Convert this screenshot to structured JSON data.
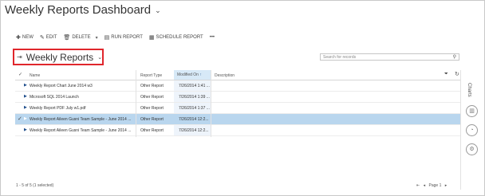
{
  "header": {
    "title": "Weekly Reports Dashboard"
  },
  "toolbar": {
    "new": "NEW",
    "edit": "EDIT",
    "delete": "DELETE",
    "run_report": "RUN REPORT",
    "schedule_report": "SCHEDULE REPORT",
    "more": "•••"
  },
  "view": {
    "name": "Weekly Reports"
  },
  "search": {
    "placeholder": "Search for records"
  },
  "grid": {
    "columns": {
      "name": "Name",
      "report_type": "Report Type",
      "modified_on": "Modified On",
      "description": "Description"
    },
    "rows": [
      {
        "name": "Weekly Report Chart June 2014 w3",
        "report_type": "Other Report",
        "modified_on": "7/26/2014 1:41 ...",
        "selected": false
      },
      {
        "name": "Microsoft SQL 2014 Launch",
        "report_type": "Other Report",
        "modified_on": "7/26/2014 1:39 ...",
        "selected": false
      },
      {
        "name": "Weekly Report PDF July w1.pdf",
        "report_type": "Other Report",
        "modified_on": "7/26/2014 1:37 ...",
        "selected": false
      },
      {
        "name": "Weekly Report Aileen Gusni Team Sample - June 2014 ...",
        "report_type": "Other Report",
        "modified_on": "7/26/2014 12:2...",
        "selected": true
      },
      {
        "name": "Weekly Report Aileen Gusni Team Sample - June 2014 ...",
        "report_type": "Other Report",
        "modified_on": "7/26/2014 12:2...",
        "selected": false
      }
    ]
  },
  "side_pane": {
    "label": "Charts"
  },
  "footer": {
    "status": "1 - 5 of 5 (1 selected)"
  },
  "pager": {
    "page_label": "Page 1"
  },
  "colors": {
    "accent": "#e0262c",
    "selected_row": "#b9d6ee",
    "sorted_column": "#d7e9f7"
  }
}
